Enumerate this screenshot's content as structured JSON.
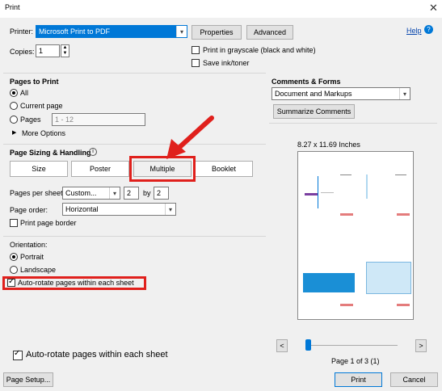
{
  "window": {
    "title": "Print",
    "help": "Help"
  },
  "printer": {
    "label": "Printer:",
    "value": "Microsoft Print to PDF",
    "properties": "Properties",
    "advanced": "Advanced",
    "copies_label": "Copies:",
    "copies_value": "1",
    "grayscale": "Print in grayscale (black and white)",
    "save_ink": "Save ink/toner"
  },
  "pages_to_print": {
    "title": "Pages to Print",
    "all": "All",
    "current": "Current page",
    "pages": "Pages",
    "pages_range": "1 - 12",
    "more": "More Options"
  },
  "sizing": {
    "title": "Page Sizing & Handling",
    "size": "Size",
    "poster": "Poster",
    "multiple": "Multiple",
    "booklet": "Booklet",
    "pps_label": "Pages per sheet:",
    "pps_value": "Custom...",
    "pps_x": "2",
    "by": "by",
    "pps_y": "2",
    "order_label": "Page order:",
    "order_value": "Horizontal",
    "border": "Print page border"
  },
  "orientation": {
    "title": "Orientation:",
    "portrait": "Portrait",
    "landscape": "Landscape",
    "autorotate": "Auto-rotate pages within each sheet"
  },
  "callout": {
    "autorotate": "Auto-rotate pages within each sheet"
  },
  "comments": {
    "title": "Comments & Forms",
    "value": "Document and Markups",
    "summarize": "Summarize Comments"
  },
  "preview": {
    "size": "8.27 x 11.69 Inches",
    "prev": "<",
    "next": ">",
    "page_label": "Page 1 of 3 (1)"
  },
  "footer": {
    "setup": "Page Setup...",
    "print": "Print",
    "cancel": "Cancel"
  },
  "colors": {
    "accent": "#0078d7",
    "highlight": "#e0201c"
  }
}
